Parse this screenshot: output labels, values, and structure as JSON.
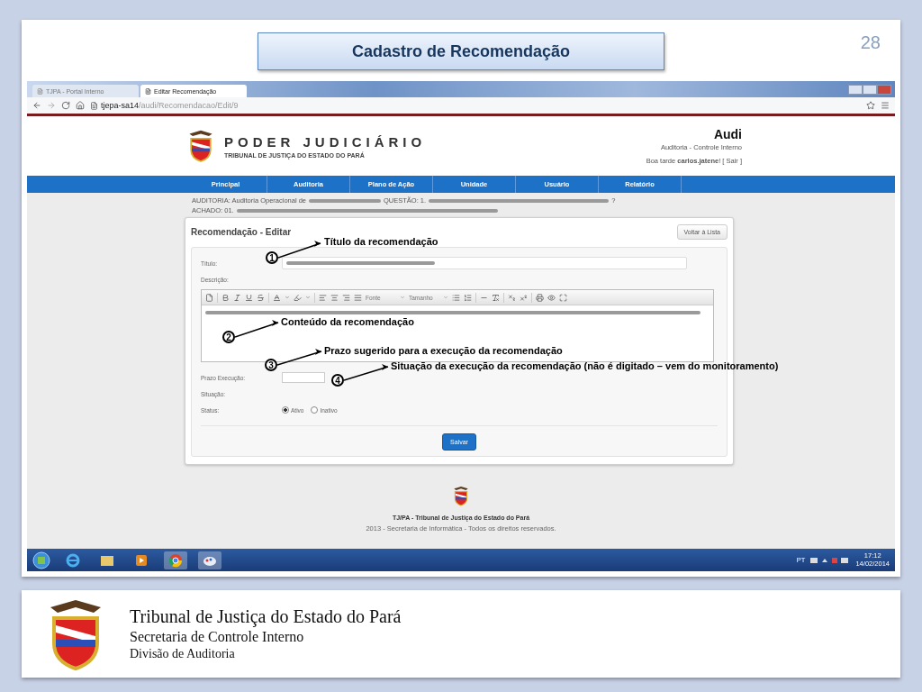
{
  "slide": {
    "title": "Cadastro de Recomendação",
    "number": "28"
  },
  "browser": {
    "tabs": [
      {
        "label": "TJPA - Portal Interno",
        "selected": false
      },
      {
        "label": "Editar Recomendação",
        "selected": true
      }
    ],
    "address_host": "tjepa-sa14",
    "address_path": "/audi/Recomendacao/Edit/9"
  },
  "site_header": {
    "title": "PODER JUDICIÁRIO",
    "subtitle": "TRIBUNAL DE JUSTIÇA DO ESTADO DO PARÁ",
    "app_name": "Audi",
    "app_subtitle": "Auditoria - Controle Interno",
    "greeting": "Boa tarde **carlos.jatene**! [ Sair ]"
  },
  "nav": [
    "Principal",
    "Auditoria",
    "Plano de Ação",
    "Unidade",
    "Usuário",
    "Relatório"
  ],
  "breadcrumb": {
    "auditoria_label": "AUDITORIA: Auditoria Operacional de",
    "questao_label": "QUESTÃO: 1.",
    "questao_end": "?",
    "achado_label": "ACHADO: 01."
  },
  "form": {
    "heading": "Recomendação - Editar",
    "back_button": "Voltar à Lista",
    "fields": [
      {
        "kind": "text",
        "label": "Título:"
      },
      {
        "kind": "editor",
        "label": "Descrição:",
        "toolbar_dropdowns": [
          "Fonte",
          "Tamanho"
        ]
      },
      {
        "kind": "short",
        "label": "Prazo Execução:"
      },
      {
        "kind": "static",
        "label": "Situação:"
      },
      {
        "kind": "radio",
        "label": "Status:",
        "options": [
          {
            "label": "Ativo",
            "selected": true
          },
          {
            "label": "Inativo",
            "selected": false
          }
        ]
      }
    ],
    "submit": "Salvar"
  },
  "annotations": [
    {
      "number": "1",
      "text": "Título da recomendação"
    },
    {
      "number": "2",
      "text": "Conteúdo da recomendação"
    },
    {
      "number": "3",
      "text": "Prazo sugerido para a execução da recomendação"
    },
    {
      "number": "4",
      "text": "Situação da execução da recomendação (não é digitado – vem do monitoramento)"
    }
  ],
  "footer": {
    "title": "TJ/PA - Tribunal de Justiça do Estado do Pará",
    "copyright": "2013 - Secretaria de Informática - Todos os direitos reservados."
  },
  "taskbar": {
    "language": "PT",
    "time": "17:12",
    "date": "14/02/2014"
  },
  "slide_footer": {
    "lines": [
      "Tribunal de Justiça do Estado do Pará",
      "Secretaria de Controle Interno",
      "Divisão de Auditoria"
    ]
  }
}
